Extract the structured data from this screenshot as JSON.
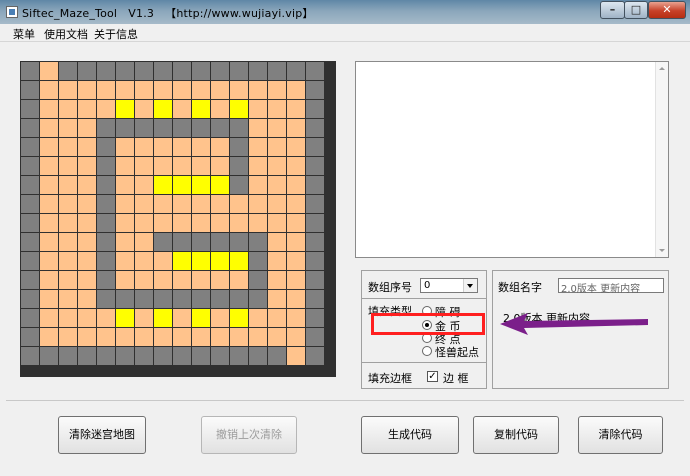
{
  "window": {
    "title": "Siftec_Maze_Tool   V1.3   【http://www.wujiayi.vip】",
    "controls": {
      "minimize": "–",
      "maximize": "□",
      "close": "✕"
    }
  },
  "menu": [
    "菜单",
    "使用文档",
    "关于信息"
  ],
  "maze": {
    "rows": 16,
    "cols": 16,
    "legend": {
      "W": "wall",
      "F": "fill",
      "G": "gold"
    },
    "colors": {
      "wall": "#808080",
      "fill": "#ffc38c",
      "gold": "#ffff00"
    },
    "grid": [
      "WFWWWWWWWWWWWWWW",
      "WFFFFFFFFFFFFFFW",
      "WFFFFGFGFGFGFFFW",
      "WFFFWWWWWWWWFFFW",
      "WFFFWFFFFFFWFFFW",
      "WFFFWFFFFFFWFFFW",
      "WFFFWFFGGGGWFFFW",
      "WFFFWFFFFFFFFFFW",
      "WFFFWFFFFFFFFFFW",
      "WFFFWFFWWWWWWFFW",
      "WFFFWFFFGGGGWFFW",
      "WFFFWFFFFFFFWFFW",
      "WFFFWWWWWWWWWFFW",
      "WFFFFGFGFGFGFFFW",
      "WFFFFFFFFFFFFFFW",
      "WWWWWWWWWWWWWWFW"
    ]
  },
  "controls_panel": {
    "array_index_label": "数组序号",
    "array_index_value": "0",
    "array_name_label": "数组名字",
    "array_name_value": "2.0版本 更新内容",
    "fill_type_label": "填充类型",
    "fill_options": [
      {
        "label": "障  碍",
        "checked": false
      },
      {
        "label": "金  币",
        "checked": true
      },
      {
        "label": "终  点",
        "checked": false
      },
      {
        "label": "怪兽起点",
        "checked": false
      }
    ],
    "fill_border_label": "填充边框",
    "border_checkbox": {
      "label": "边  框",
      "checked": true,
      "mark": "✓"
    },
    "info_text": "2.0版本 更新内容"
  },
  "annotation_colors": {
    "highlight": "#ff1f1f",
    "arrow": "#7b1f8a"
  },
  "buttons": [
    {
      "label": "清除迷宫地图",
      "enabled": true
    },
    {
      "label": "撤销上次清除",
      "enabled": false
    },
    {
      "label": "生成代码",
      "enabled": true
    },
    {
      "label": "复制代码",
      "enabled": true
    },
    {
      "label": "清除代码",
      "enabled": true
    }
  ]
}
